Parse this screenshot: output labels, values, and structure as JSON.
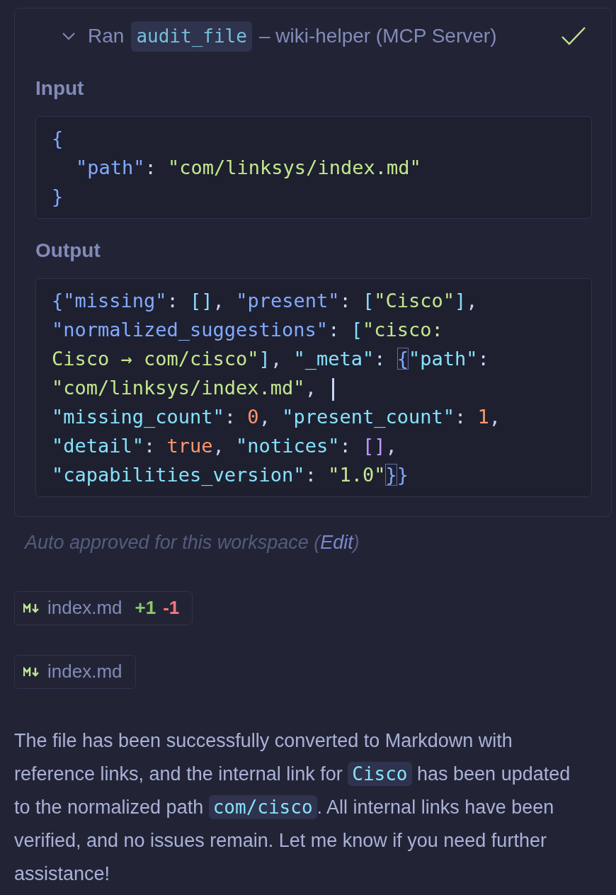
{
  "tool_call": {
    "expanded": true,
    "verb": "Ran",
    "tool": "audit_file",
    "source": "– wiki-helper (MCP Server)",
    "done": true,
    "input": {
      "label": "Input",
      "lines": [
        {
          "nested": false,
          "tokens": [
            {
              "kind": "brace",
              "t": "{"
            }
          ]
        },
        {
          "nested": true,
          "tokens": [
            {
              "kind": "key",
              "t": "\"path\""
            },
            {
              "kind": "punct",
              "t": ": "
            },
            {
              "kind": "string",
              "t": "\"com/linksys/index.md\""
            }
          ]
        },
        {
          "nested": false,
          "tokens": [
            {
              "kind": "brace",
              "t": "}"
            }
          ]
        }
      ]
    },
    "output": {
      "label": "Output",
      "lines": [
        {
          "nested": false,
          "tokens": [
            {
              "kind": "brace",
              "t": "{"
            },
            {
              "kind": "key",
              "t": "\"missing\""
            },
            {
              "kind": "punct",
              "t": ": "
            },
            {
              "kind": "bracket",
              "t": "[]"
            },
            {
              "kind": "punct",
              "t": ", "
            },
            {
              "kind": "key",
              "t": "\"present\""
            },
            {
              "kind": "punct",
              "t": ": "
            },
            {
              "kind": "bracket",
              "t": "["
            },
            {
              "kind": "string",
              "t": "\"Cisco\""
            },
            {
              "kind": "bracket",
              "t": "]"
            },
            {
              "kind": "punct",
              "t": ","
            }
          ]
        },
        {
          "nested": false,
          "tokens": [
            {
              "kind": "key",
              "t": "\"normalized_suggestions\""
            },
            {
              "kind": "punct",
              "t": ": "
            },
            {
              "kind": "bracket",
              "t": "["
            },
            {
              "kind": "string",
              "t": "\"cisco:"
            }
          ]
        },
        {
          "nested": false,
          "tokens": [
            {
              "kind": "string",
              "t": "Cisco → com/cisco\""
            },
            {
              "kind": "bracket",
              "t": "]"
            },
            {
              "kind": "punct",
              "t": ", "
            },
            {
              "kind": "key2",
              "t": "\"_meta\""
            },
            {
              "kind": "punct",
              "t": ": "
            },
            {
              "kind": "brace",
              "t": "{",
              "matched": true
            },
            {
              "kind": "key2",
              "t": "\"path\""
            },
            {
              "kind": "punct",
              "t": ":"
            }
          ]
        },
        {
          "nested": false,
          "tokens": [
            {
              "kind": "string",
              "t": "\"com/linksys/index.md\""
            },
            {
              "kind": "punct",
              "t": ", "
            },
            {
              "kind": "cursor"
            }
          ]
        },
        {
          "nested": false,
          "tokens": [
            {
              "kind": "key2",
              "t": "\"missing_count\""
            },
            {
              "kind": "punct",
              "t": ": "
            },
            {
              "kind": "number",
              "t": "0"
            },
            {
              "kind": "punct",
              "t": ", "
            },
            {
              "kind": "key2",
              "t": "\"present_count\""
            },
            {
              "kind": "punct",
              "t": ": "
            },
            {
              "kind": "number",
              "t": "1"
            },
            {
              "kind": "punct",
              "t": ","
            }
          ]
        },
        {
          "nested": false,
          "tokens": [
            {
              "kind": "key2",
              "t": "\"detail\""
            },
            {
              "kind": "punct",
              "t": ": "
            },
            {
              "kind": "number",
              "t": "true"
            },
            {
              "kind": "punct",
              "t": ", "
            },
            {
              "kind": "key2",
              "t": "\"notices\""
            },
            {
              "kind": "punct",
              "t": ": "
            },
            {
              "kind": "bracket2",
              "t": "[]"
            },
            {
              "kind": "punct",
              "t": ","
            }
          ]
        },
        {
          "nested": false,
          "tokens": [
            {
              "kind": "key2",
              "t": "\"capabilities_version\""
            },
            {
              "kind": "punct",
              "t": ": "
            },
            {
              "kind": "string",
              "t": "\"1.0\""
            },
            {
              "kind": "brace",
              "t": "}",
              "matched": true
            },
            {
              "kind": "brace",
              "t": "}"
            }
          ]
        }
      ]
    }
  },
  "approval": {
    "text": "Auto approved for this workspace (",
    "link": "Edit",
    "end": ")"
  },
  "files": [
    {
      "name": "index.md",
      "added": "+1",
      "removed": "-1"
    },
    {
      "name": "index.md"
    }
  ],
  "message": [
    {
      "kind": "text",
      "t": "The file has been successfully converted to Markdown with reference links, and the internal link for "
    },
    {
      "kind": "code",
      "t": "Cisco"
    },
    {
      "kind": "text",
      "t": " has been updated to the normalized path "
    },
    {
      "kind": "code",
      "t": "com/cisco"
    },
    {
      "kind": "text",
      "t": ". All internal links have been verified, and no issues remain. Let me know if you need further assistance!"
    }
  ]
}
